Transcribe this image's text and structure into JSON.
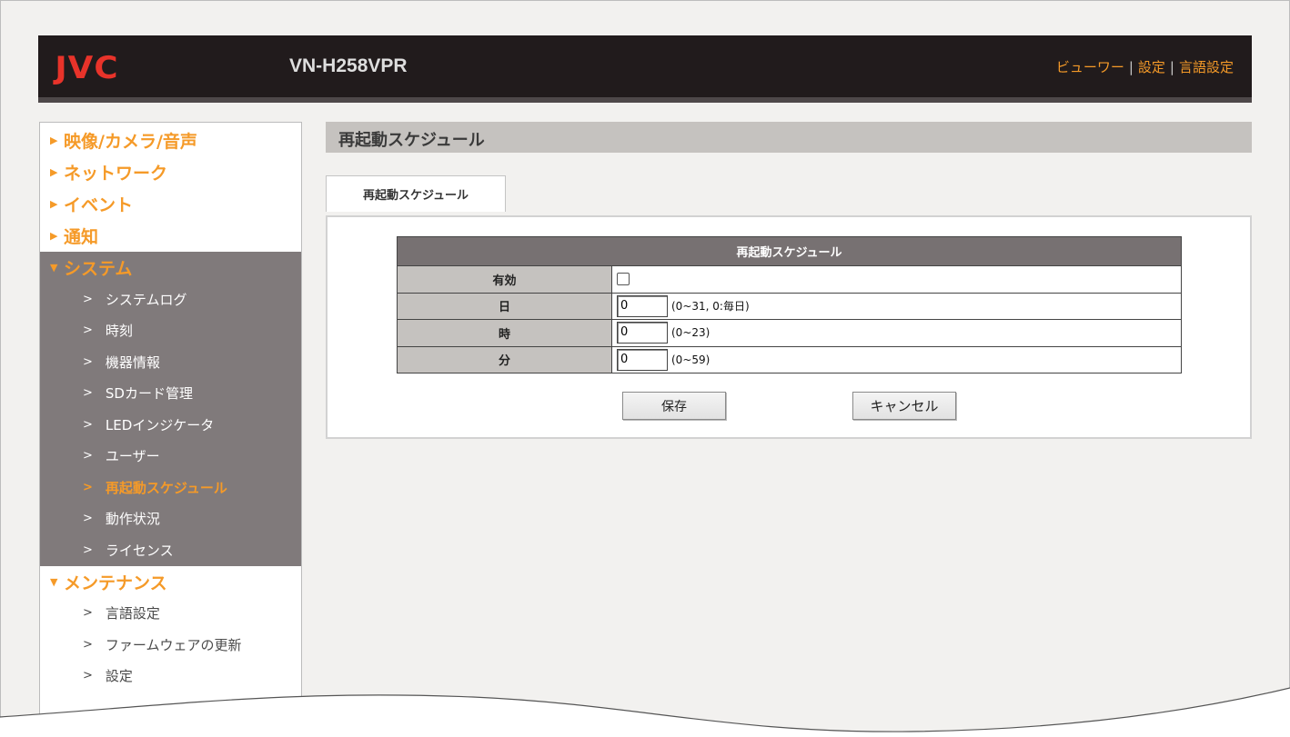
{
  "header": {
    "logo": "JVC",
    "model": "VN-H258VPR",
    "links": [
      "ビューワー",
      "設定",
      "言語設定"
    ],
    "separator": "|"
  },
  "sidebar": {
    "categories": [
      {
        "label": "映像/カメラ/音声",
        "arrow": "▶"
      },
      {
        "label": "ネットワーク",
        "arrow": "▶"
      },
      {
        "label": "イベント",
        "arrow": "▶"
      },
      {
        "label": "通知",
        "arrow": "▶"
      }
    ],
    "system": {
      "label": "システム",
      "arrow": "▼",
      "items": [
        "システムログ",
        "時刻",
        "機器情報",
        "SDカード管理",
        "LEDインジケータ",
        "ユーザー",
        "再起動スケジュール",
        "動作状況",
        "ライセンス"
      ],
      "active_index": 6
    },
    "maintenance": {
      "label": "メンテナンス",
      "arrow": "▼",
      "items": [
        "言語設定",
        "ファームウェアの更新",
        "設定"
      ]
    },
    "item_marker": ">"
  },
  "main": {
    "page_title": "再起動スケジュール",
    "tab_label": "再起動スケジュール",
    "table": {
      "header": "再起動スケジュール",
      "rows": {
        "enabled": {
          "label": "有効",
          "checked": false
        },
        "day": {
          "label": "日",
          "value": "0",
          "hint": "(0~31, 0:毎日)"
        },
        "hour": {
          "label": "時",
          "value": "0",
          "hint": "(0~23)"
        },
        "minute": {
          "label": "分",
          "value": "0",
          "hint": "(0~59)"
        }
      }
    },
    "buttons": {
      "save": "保存",
      "cancel": "キャンセル"
    }
  },
  "colors": {
    "accent": "#f59a28",
    "logo": "#e8332a",
    "header_bg": "#211b1c",
    "sidebar_active_bg": "#807a7b"
  }
}
